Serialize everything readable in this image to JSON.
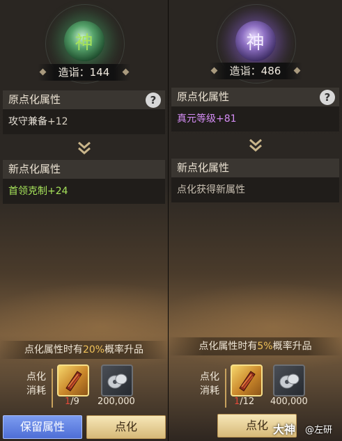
{
  "left": {
    "orb_char": "神",
    "zaoyi": "造诣：144",
    "original_header": "原点化属性",
    "original_attr": "攻守兼备",
    "original_value": "+12",
    "new_header": "新点化属性",
    "new_attr": "首领克制",
    "new_value": "+24",
    "chance_prefix": "点化属性时有",
    "chance_pct": "20%",
    "chance_suffix": "概率升品",
    "cost_label": "点化消耗",
    "item_have": "1",
    "item_need": "/9",
    "silver": "200,000",
    "btn_keep": "保留属性",
    "btn_refine": "点化",
    "orb_color": "#55a26a"
  },
  "right": {
    "orb_char": "神",
    "zaoyi": "造诣：486",
    "original_header": "原点化属性",
    "original_attr": "真元等级",
    "original_value": "+81",
    "new_header": "新点化属性",
    "new_placeholder": "点化获得新属性",
    "chance_prefix": "点化属性时有",
    "chance_pct": "5%",
    "chance_suffix": "概率升品",
    "cost_label": "点化消耗",
    "item_have": "1",
    "item_need": "/12",
    "silver": "400,000",
    "btn_refine": "点化",
    "orb_color": "#8d6fc2"
  },
  "help_icon": "?",
  "watermark": {
    "brand": "大神",
    "user": "@左研"
  },
  "colors": {
    "attr_green": "#a6e35a",
    "attr_purple": "#d58df5",
    "chance_highlight": "#f1c35a",
    "count_red": "#e4493a"
  }
}
